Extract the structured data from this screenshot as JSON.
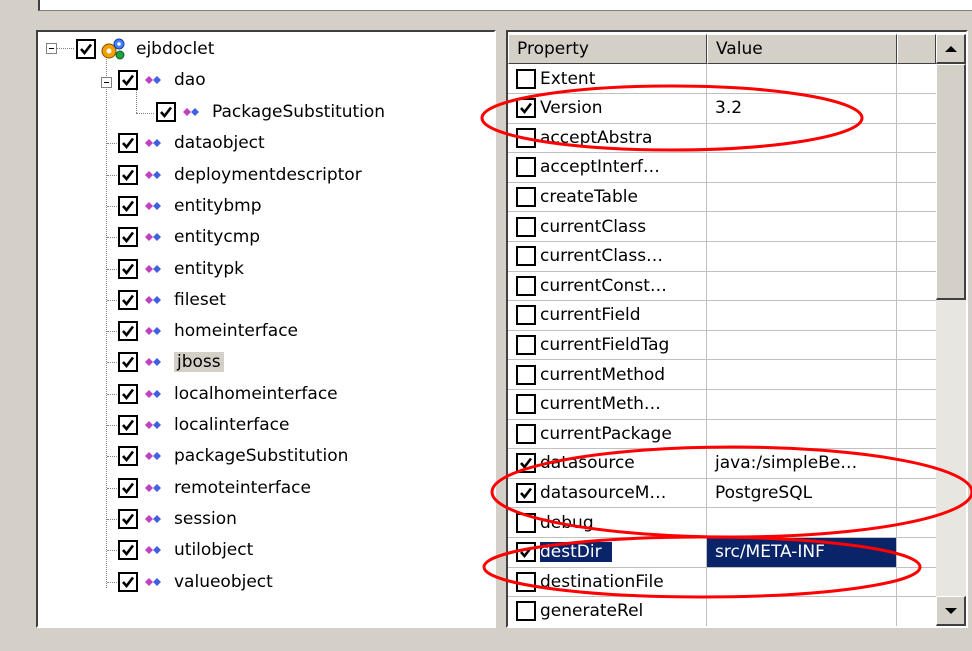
{
  "tree": {
    "root": {
      "label": "ejbdoclet",
      "checked": true,
      "icon": "gears-icon"
    },
    "items": [
      {
        "label": "dao",
        "checked": true,
        "icon": "diamond-icon"
      },
      {
        "label": "PackageSubstitution",
        "checked": true,
        "icon": "diamond-icon"
      },
      {
        "label": "dataobject",
        "checked": true,
        "icon": "diamond-icon"
      },
      {
        "label": "deploymentdescriptor",
        "checked": true,
        "icon": "diamond-icon"
      },
      {
        "label": "entitybmp",
        "checked": true,
        "icon": "diamond-icon"
      },
      {
        "label": "entitycmp",
        "checked": true,
        "icon": "diamond-icon"
      },
      {
        "label": "entitypk",
        "checked": true,
        "icon": "diamond-icon"
      },
      {
        "label": "fileset",
        "checked": true,
        "icon": "diamond-icon"
      },
      {
        "label": "homeinterface",
        "checked": true,
        "icon": "diamond-icon"
      },
      {
        "label": "jboss",
        "checked": true,
        "icon": "diamond-icon",
        "selected": true
      },
      {
        "label": "localhomeinterface",
        "checked": true,
        "icon": "diamond-icon"
      },
      {
        "label": "localinterface",
        "checked": true,
        "icon": "diamond-icon"
      },
      {
        "label": "packageSubstitution",
        "checked": true,
        "icon": "diamond-icon"
      },
      {
        "label": "remoteinterface",
        "checked": true,
        "icon": "diamond-icon"
      },
      {
        "label": "session",
        "checked": true,
        "icon": "diamond-icon"
      },
      {
        "label": "utilobject",
        "checked": true,
        "icon": "diamond-icon"
      },
      {
        "label": "valueobject",
        "checked": true,
        "icon": "diamond-icon"
      }
    ]
  },
  "properties": {
    "headers": {
      "property": "Property",
      "value": "Value"
    },
    "rows": [
      {
        "name": "Extent",
        "value": "",
        "checked": false
      },
      {
        "name": "Version",
        "value": "3.2",
        "checked": true
      },
      {
        "name": "acceptAbstra",
        "value": "",
        "checked": false
      },
      {
        "name": "acceptInterf…",
        "value": "",
        "checked": false
      },
      {
        "name": "createTable",
        "value": "",
        "checked": false
      },
      {
        "name": "currentClass",
        "value": "",
        "checked": false
      },
      {
        "name": "currentClass…",
        "value": "",
        "checked": false
      },
      {
        "name": "currentConst…",
        "value": "",
        "checked": false
      },
      {
        "name": "currentField",
        "value": "",
        "checked": false
      },
      {
        "name": "currentFieldTag",
        "value": "",
        "checked": false
      },
      {
        "name": "currentMethod",
        "value": "",
        "checked": false
      },
      {
        "name": "currentMeth…",
        "value": "",
        "checked": false
      },
      {
        "name": "currentPackage",
        "value": "",
        "checked": false
      },
      {
        "name": "datasource",
        "value": "java:/simpleBe…",
        "checked": true
      },
      {
        "name": "datasourceM…",
        "value": "PostgreSQL",
        "checked": true
      },
      {
        "name": "debug",
        "value": "",
        "checked": false
      },
      {
        "name": "destDir",
        "value": "src/META-INF",
        "checked": true,
        "selected": true
      },
      {
        "name": "destinationFile",
        "value": "",
        "checked": false
      },
      {
        "name": "generateRel",
        "value": "",
        "checked": false
      }
    ]
  },
  "colors": {
    "selection": "#0a246a",
    "annotation": "#ff0000",
    "panel": "#d4d0c8"
  }
}
